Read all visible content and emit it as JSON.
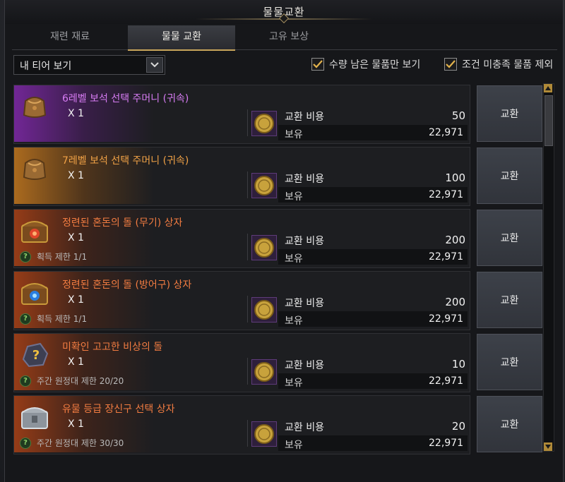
{
  "window": {
    "title": "물물교환"
  },
  "tabs": [
    {
      "label": "재련 재료",
      "active": false
    },
    {
      "label": "물물 교환",
      "active": true
    },
    {
      "label": "고유 보상",
      "active": false
    }
  ],
  "filters": {
    "dropdown_value": "내 티어 보기",
    "checkbox1_label": "수량 남은 물품만 보기",
    "checkbox1_checked": true,
    "checkbox2_label": "조건 미충족 물품 제외",
    "checkbox2_checked": true
  },
  "items": [
    {
      "name": "6레벨 보석 선택 주머니 (귀속)",
      "grade": "purple",
      "icon": "pouch-icon",
      "qty": "X 1",
      "limit": "",
      "cost_label": "교환 비용",
      "cost": "50",
      "owned_label": "보유",
      "owned": "22,971",
      "button": "교환"
    },
    {
      "name": "7레벨 보석 선택 주머니 (귀속)",
      "grade": "orange",
      "icon": "pouch-icon",
      "qty": "X 1",
      "limit": "",
      "cost_label": "교환 비용",
      "cost": "100",
      "owned_label": "보유",
      "owned": "22,971",
      "button": "교환"
    },
    {
      "name": "정련된 혼돈의 돌 (무기) 상자",
      "grade": "red",
      "icon": "chest-red-icon",
      "qty": "X 1",
      "limit": "획득 제한 1/1",
      "cost_label": "교환 비용",
      "cost": "200",
      "owned_label": "보유",
      "owned": "22,971",
      "button": "교환"
    },
    {
      "name": "정련된 혼돈의 돌 (방어구) 상자",
      "grade": "red",
      "icon": "chest-blue-icon",
      "qty": "X 1",
      "limit": "획득 제한 1/1",
      "cost_label": "교환 비용",
      "cost": "200",
      "owned_label": "보유",
      "owned": "22,971",
      "button": "교환"
    },
    {
      "name": "미확인 고고한 비상의 돌",
      "grade": "red",
      "icon": "mystery-stone-icon",
      "qty": "X 1",
      "limit": "주간 원정대 제한 20/20",
      "cost_label": "교환 비용",
      "cost": "10",
      "owned_label": "보유",
      "owned": "22,971",
      "button": "교환"
    },
    {
      "name": "유물 등급 장신구 선택 상자",
      "grade": "red",
      "icon": "silver-chest-icon",
      "qty": "X 1",
      "limit": "주간 원정대 제한 30/30",
      "cost_label": "교환 비용",
      "cost": "20",
      "owned_label": "보유",
      "owned": "22,971",
      "button": "교환"
    }
  ]
}
